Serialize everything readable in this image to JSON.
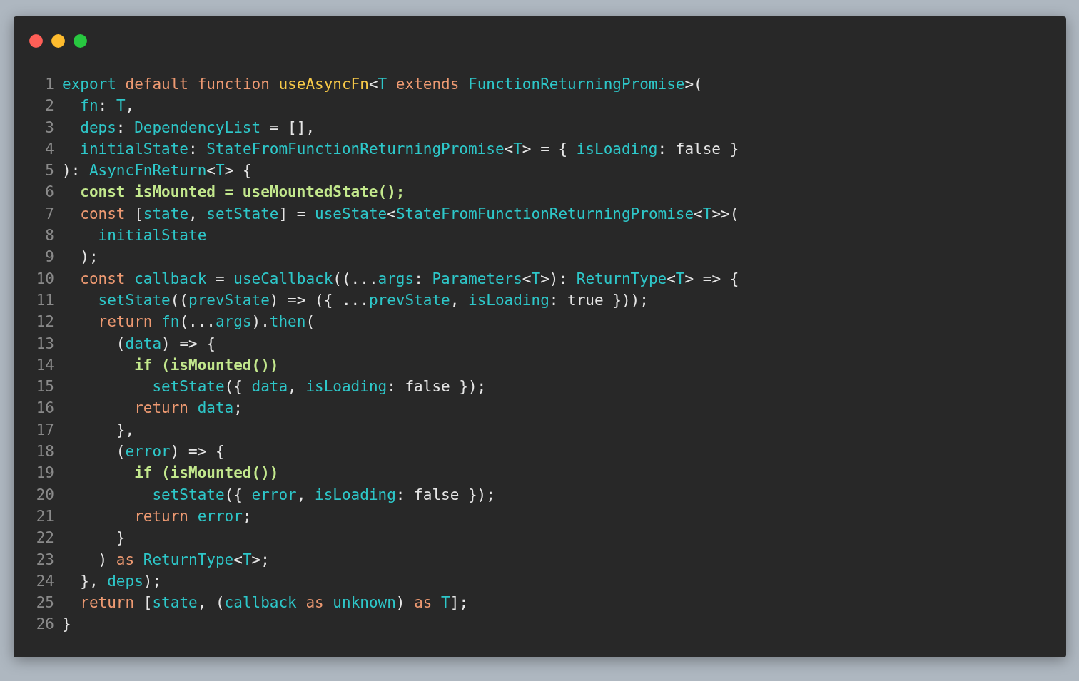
{
  "window": {
    "controls": [
      {
        "kind": "close"
      },
      {
        "kind": "minimize"
      },
      {
        "kind": "zoom"
      }
    ]
  },
  "lines": [
    {
      "n": "1",
      "highlighted": false,
      "tokens": [
        {
          "kind": "identifier",
          "text": "export "
        },
        {
          "kind": "keyword",
          "text": "default function "
        },
        {
          "kind": "function",
          "text": "useAsyncFn"
        },
        {
          "kind": "plain",
          "text": "<"
        },
        {
          "kind": "identifier",
          "text": "T "
        },
        {
          "kind": "keyword",
          "text": "extends "
        },
        {
          "kind": "identifier",
          "text": "FunctionReturningPromise"
        },
        {
          "kind": "plain",
          "text": ">("
        }
      ]
    },
    {
      "n": "2",
      "highlighted": false,
      "tokens": [
        {
          "kind": "identifier",
          "text": "  fn"
        },
        {
          "kind": "plain",
          "text": ": "
        },
        {
          "kind": "identifier",
          "text": "T"
        },
        {
          "kind": "plain",
          "text": ","
        }
      ]
    },
    {
      "n": "3",
      "highlighted": false,
      "tokens": [
        {
          "kind": "identifier",
          "text": "  deps"
        },
        {
          "kind": "plain",
          "text": ": "
        },
        {
          "kind": "identifier",
          "text": "DependencyList"
        },
        {
          "kind": "plain",
          "text": " = [],"
        }
      ]
    },
    {
      "n": "4",
      "highlighted": false,
      "tokens": [
        {
          "kind": "identifier",
          "text": "  initialState"
        },
        {
          "kind": "plain",
          "text": ": "
        },
        {
          "kind": "identifier",
          "text": "StateFromFunctionReturningPromise"
        },
        {
          "kind": "plain",
          "text": "<"
        },
        {
          "kind": "identifier",
          "text": "T"
        },
        {
          "kind": "plain",
          "text": "> = { "
        },
        {
          "kind": "identifier",
          "text": "isLoading"
        },
        {
          "kind": "plain",
          "text": ": false }"
        }
      ]
    },
    {
      "n": "5",
      "highlighted": false,
      "tokens": [
        {
          "kind": "plain",
          "text": "): "
        },
        {
          "kind": "identifier",
          "text": "AsyncFnReturn"
        },
        {
          "kind": "plain",
          "text": "<"
        },
        {
          "kind": "identifier",
          "text": "T"
        },
        {
          "kind": "plain",
          "text": "> {"
        }
      ]
    },
    {
      "n": "6",
      "highlighted": true,
      "tokens": [
        {
          "kind": "emphasis",
          "text": "  const isMounted = useMountedState();"
        }
      ]
    },
    {
      "n": "7",
      "highlighted": false,
      "tokens": [
        {
          "kind": "keyword",
          "text": "  const"
        },
        {
          "kind": "plain",
          "text": " ["
        },
        {
          "kind": "identifier",
          "text": "state"
        },
        {
          "kind": "plain",
          "text": ", "
        },
        {
          "kind": "identifier",
          "text": "setState"
        },
        {
          "kind": "plain",
          "text": "] = "
        },
        {
          "kind": "identifier",
          "text": "useState"
        },
        {
          "kind": "plain",
          "text": "<"
        },
        {
          "kind": "identifier",
          "text": "StateFromFunctionReturningPromise"
        },
        {
          "kind": "plain",
          "text": "<"
        },
        {
          "kind": "identifier",
          "text": "T"
        },
        {
          "kind": "plain",
          "text": ">>("
        }
      ]
    },
    {
      "n": "8",
      "highlighted": false,
      "tokens": [
        {
          "kind": "identifier",
          "text": "    initialState"
        }
      ]
    },
    {
      "n": "9",
      "highlighted": false,
      "tokens": [
        {
          "kind": "plain",
          "text": "  );"
        }
      ]
    },
    {
      "n": "10",
      "highlighted": false,
      "tokens": [
        {
          "kind": "keyword",
          "text": "  const "
        },
        {
          "kind": "identifier",
          "text": "callback"
        },
        {
          "kind": "plain",
          "text": " = "
        },
        {
          "kind": "identifier",
          "text": "useCallback"
        },
        {
          "kind": "plain",
          "text": "((..."
        },
        {
          "kind": "identifier",
          "text": "args"
        },
        {
          "kind": "plain",
          "text": ": "
        },
        {
          "kind": "identifier",
          "text": "Parameters"
        },
        {
          "kind": "plain",
          "text": "<"
        },
        {
          "kind": "identifier",
          "text": "T"
        },
        {
          "kind": "plain",
          "text": ">): "
        },
        {
          "kind": "identifier",
          "text": "ReturnType"
        },
        {
          "kind": "plain",
          "text": "<"
        },
        {
          "kind": "identifier",
          "text": "T"
        },
        {
          "kind": "plain",
          "text": "> => {"
        }
      ]
    },
    {
      "n": "11",
      "highlighted": false,
      "tokens": [
        {
          "kind": "identifier",
          "text": "    setState"
        },
        {
          "kind": "plain",
          "text": "(("
        },
        {
          "kind": "identifier",
          "text": "prevState"
        },
        {
          "kind": "plain",
          "text": ") => ({ ..."
        },
        {
          "kind": "identifier",
          "text": "prevState"
        },
        {
          "kind": "plain",
          "text": ", "
        },
        {
          "kind": "identifier",
          "text": "isLoading"
        },
        {
          "kind": "plain",
          "text": ": true }));"
        }
      ]
    },
    {
      "n": "12",
      "highlighted": false,
      "tokens": [
        {
          "kind": "keyword",
          "text": "    return "
        },
        {
          "kind": "identifier",
          "text": "fn"
        },
        {
          "kind": "plain",
          "text": "(..."
        },
        {
          "kind": "identifier",
          "text": "args"
        },
        {
          "kind": "plain",
          "text": ")."
        },
        {
          "kind": "identifier",
          "text": "then"
        },
        {
          "kind": "plain",
          "text": "("
        }
      ]
    },
    {
      "n": "13",
      "highlighted": false,
      "tokens": [
        {
          "kind": "plain",
          "text": "      ("
        },
        {
          "kind": "identifier",
          "text": "data"
        },
        {
          "kind": "plain",
          "text": ") => {"
        }
      ]
    },
    {
      "n": "14",
      "highlighted": true,
      "tokens": [
        {
          "kind": "emphasis",
          "text": "        if (isMounted())"
        }
      ]
    },
    {
      "n": "15",
      "highlighted": false,
      "tokens": [
        {
          "kind": "identifier",
          "text": "          setState"
        },
        {
          "kind": "plain",
          "text": "({ "
        },
        {
          "kind": "identifier",
          "text": "data"
        },
        {
          "kind": "plain",
          "text": ", "
        },
        {
          "kind": "identifier",
          "text": "isLoading"
        },
        {
          "kind": "plain",
          "text": ": false });"
        }
      ]
    },
    {
      "n": "16",
      "highlighted": false,
      "tokens": [
        {
          "kind": "keyword",
          "text": "        return "
        },
        {
          "kind": "identifier",
          "text": "data"
        },
        {
          "kind": "plain",
          "text": ";"
        }
      ]
    },
    {
      "n": "17",
      "highlighted": false,
      "tokens": [
        {
          "kind": "plain",
          "text": "      },"
        }
      ]
    },
    {
      "n": "18",
      "highlighted": false,
      "tokens": [
        {
          "kind": "plain",
          "text": "      ("
        },
        {
          "kind": "identifier",
          "text": "error"
        },
        {
          "kind": "plain",
          "text": ") => {"
        }
      ]
    },
    {
      "n": "19",
      "highlighted": true,
      "tokens": [
        {
          "kind": "emphasis",
          "text": "        if (isMounted())"
        }
      ]
    },
    {
      "n": "20",
      "highlighted": false,
      "tokens": [
        {
          "kind": "identifier",
          "text": "          setState"
        },
        {
          "kind": "plain",
          "text": "({ "
        },
        {
          "kind": "identifier",
          "text": "error"
        },
        {
          "kind": "plain",
          "text": ", "
        },
        {
          "kind": "identifier",
          "text": "isLoading"
        },
        {
          "kind": "plain",
          "text": ": false });"
        }
      ]
    },
    {
      "n": "21",
      "highlighted": false,
      "tokens": [
        {
          "kind": "keyword",
          "text": "        return "
        },
        {
          "kind": "identifier",
          "text": "error"
        },
        {
          "kind": "plain",
          "text": ";"
        }
      ]
    },
    {
      "n": "22",
      "highlighted": false,
      "tokens": [
        {
          "kind": "plain",
          "text": "      }"
        }
      ]
    },
    {
      "n": "23",
      "highlighted": false,
      "tokens": [
        {
          "kind": "plain",
          "text": "    ) "
        },
        {
          "kind": "keyword",
          "text": "as "
        },
        {
          "kind": "identifier",
          "text": "ReturnType"
        },
        {
          "kind": "plain",
          "text": "<"
        },
        {
          "kind": "identifier",
          "text": "T"
        },
        {
          "kind": "plain",
          "text": ">;"
        }
      ]
    },
    {
      "n": "24",
      "highlighted": false,
      "tokens": [
        {
          "kind": "plain",
          "text": "  }, "
        },
        {
          "kind": "identifier",
          "text": "deps"
        },
        {
          "kind": "plain",
          "text": ");"
        }
      ]
    },
    {
      "n": "25",
      "highlighted": false,
      "tokens": [
        {
          "kind": "keyword",
          "text": "  return"
        },
        {
          "kind": "plain",
          "text": " ["
        },
        {
          "kind": "identifier",
          "text": "state"
        },
        {
          "kind": "plain",
          "text": ", ("
        },
        {
          "kind": "identifier",
          "text": "callback "
        },
        {
          "kind": "keyword",
          "text": "as "
        },
        {
          "kind": "identifier",
          "text": "unknown"
        },
        {
          "kind": "plain",
          "text": ") "
        },
        {
          "kind": "keyword",
          "text": "as "
        },
        {
          "kind": "identifier",
          "text": "T"
        },
        {
          "kind": "plain",
          "text": "];"
        }
      ]
    },
    {
      "n": "26",
      "highlighted": false,
      "tokens": [
        {
          "kind": "plain",
          "text": "}"
        }
      ]
    }
  ]
}
